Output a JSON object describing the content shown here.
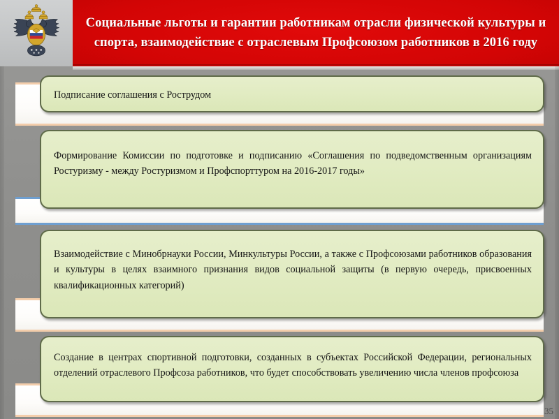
{
  "slide": {
    "page_number": "35",
    "emblem_name": "russian-coat-of-arms",
    "colors": {
      "banner_red": "#d30505",
      "box_green": "#e2ecc3",
      "box_border": "#5f6b49",
      "band_peach": "#f3cdab",
      "band_blue": "#6f9fd0",
      "background_gray": "#8f8f8d",
      "title_text": "#ffffff",
      "body_text": "#151515"
    }
  },
  "header": {
    "title": "Социальные льготы и гарантии работникам отрасли физической культуры и спорта, взаимодействие с отраслевым Профсоюзом работников в 2016 году"
  },
  "blocks": [
    {
      "id": "block-1",
      "band_accent": "peach",
      "text": "Подписание соглашения с Рострудом"
    },
    {
      "id": "block-2",
      "band_accent": "blue",
      "text": "Формирование Комиссии по подготовке и подписанию «Соглашения по подведомственным организациям Ростуризму - между Ростуризмом и Профспорттуром на 2016-2017 годы»"
    },
    {
      "id": "block-3",
      "band_accent": "peach",
      "text": "Взаимодействие с Минобрнауки России, Минкультуры России, а также с Профсоюзами работников образования и культуры в целях взаимного признания видов социальной защиты (в первую очередь, присвоенных квалификационных категорий)"
    },
    {
      "id": "block-4",
      "band_accent": "peach",
      "text": "Создание в центрах спортивной подготовки, созданных в субъектах Российской Федерации, региональных отделений отраслевого Профсоза работников, что будет способствовать увеличению числа членов профсоюза"
    }
  ]
}
